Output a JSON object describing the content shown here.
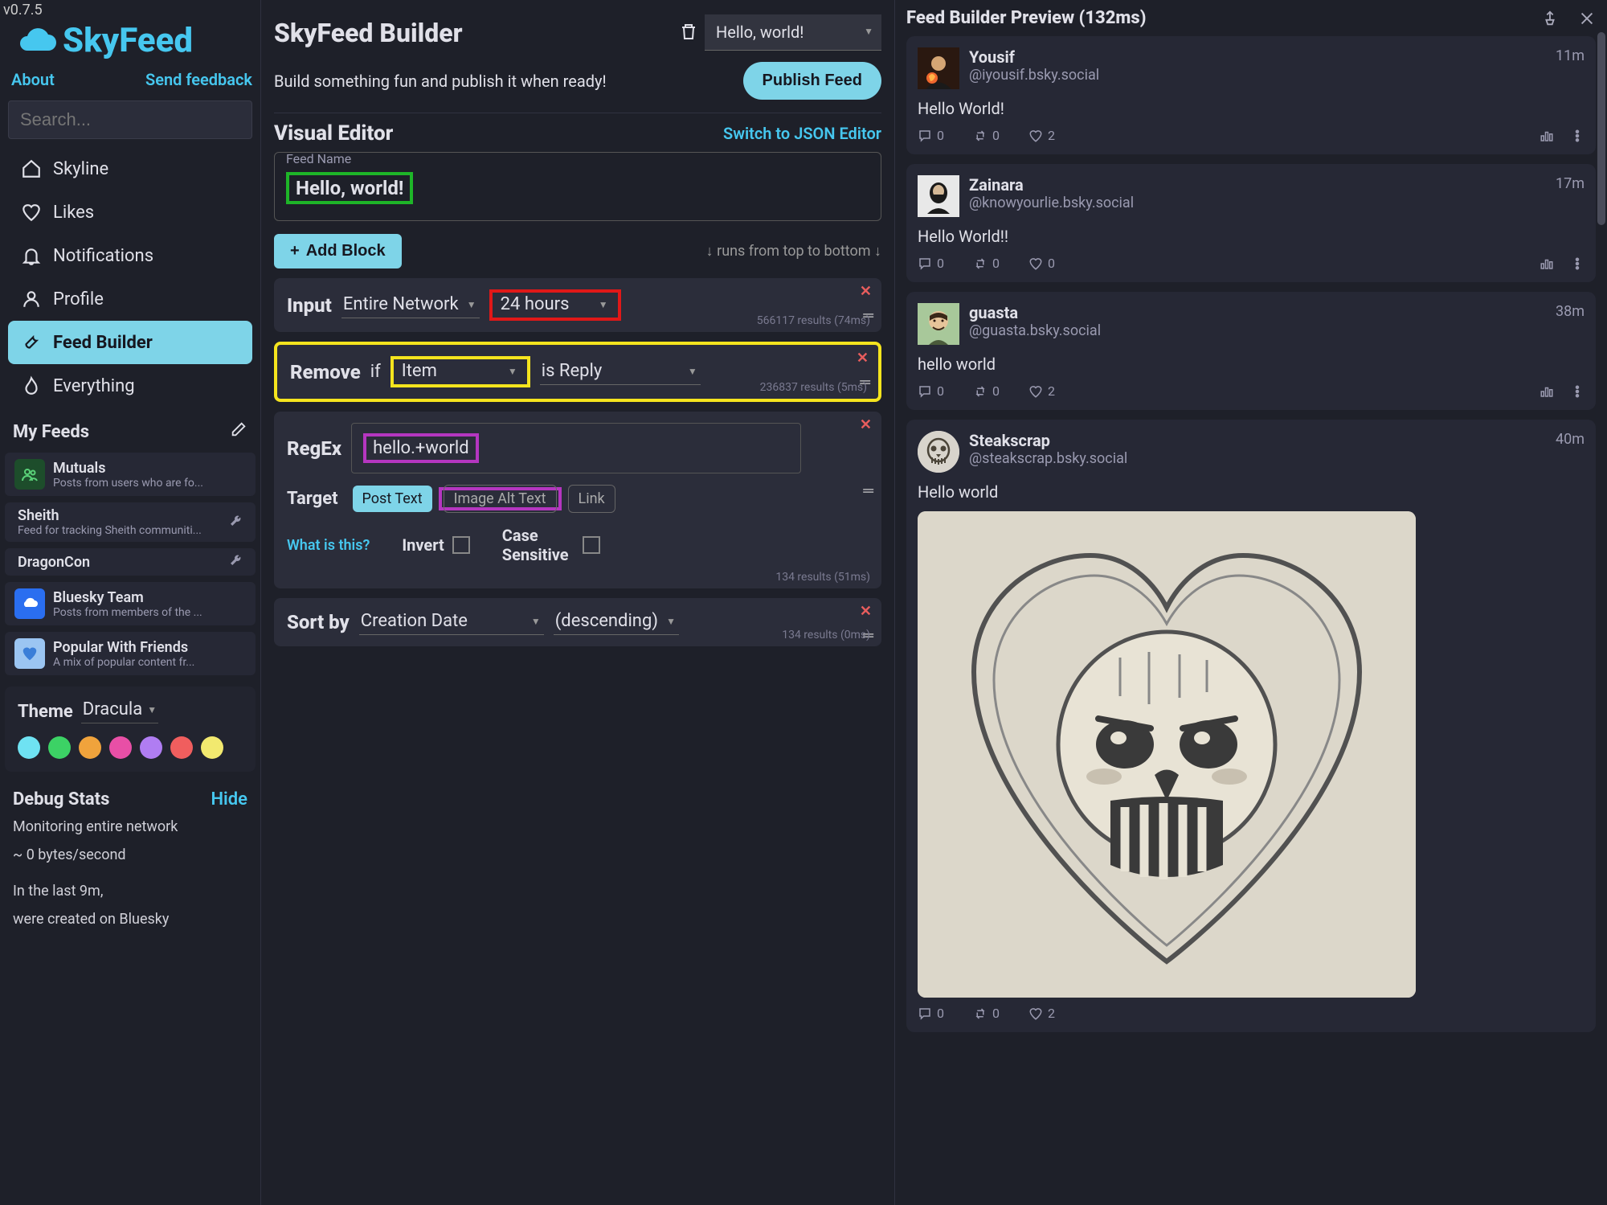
{
  "version": "v0.7.5",
  "logo": "SkyFeed",
  "top_links": {
    "about": "About",
    "feedback": "Send feedback"
  },
  "search_placeholder": "Search...",
  "nav": [
    {
      "label": "Skyline",
      "icon": "home"
    },
    {
      "label": "Likes",
      "icon": "heart"
    },
    {
      "label": "Notifications",
      "icon": "bell"
    },
    {
      "label": "Profile",
      "icon": "user"
    },
    {
      "label": "Feed Builder",
      "icon": "wrench",
      "active": true
    },
    {
      "label": "Everything",
      "icon": "flame"
    }
  ],
  "my_feeds_header": "My Feeds",
  "my_feeds": [
    {
      "title": "Mutuals",
      "sub": "Posts from users who are fo...",
      "icon": "users",
      "color": "green"
    },
    {
      "title": "Sheith",
      "sub": "Feed for tracking Sheith communiti...",
      "simple": true
    },
    {
      "title": "DragonCon",
      "sub": "",
      "simple": true
    },
    {
      "title": "Bluesky Team",
      "sub": "Posts from members of the ...",
      "icon": "cloud",
      "color": "blue"
    },
    {
      "title": "Popular With Friends",
      "sub": "A mix of popular content fr...",
      "icon": "heart",
      "color": "lightblue"
    }
  ],
  "theme": {
    "label": "Theme",
    "value": "Dracula",
    "colors": [
      "#6fe2f2",
      "#3cd265",
      "#f0a33c",
      "#e84fa6",
      "#b07df2",
      "#f05e5e",
      "#f2e96f"
    ]
  },
  "debug": {
    "title": "Debug Stats",
    "hide": "Hide",
    "line1": "Monitoring entire network",
    "line2": "~ 0 bytes/second",
    "line3": "In the last 9m,",
    "line4": "were created on Bluesky"
  },
  "builder": {
    "title": "SkyFeed Builder",
    "feed_select": "Hello, world!",
    "subtitle": "Build something fun and publish it when ready!",
    "publish": "Publish Feed",
    "editor_title": "Visual Editor",
    "json_link": "Switch to JSON Editor",
    "feed_name_label": "Feed Name",
    "feed_name_value": "Hello, world!",
    "add_block": "Add Block",
    "runs_text": "↓ runs from top to bottom ↓",
    "blocks": {
      "input": {
        "label": "Input",
        "source": "Entire Network",
        "window": "24 hours",
        "meta": "566117 results (74ms)"
      },
      "remove": {
        "label": "Remove",
        "if": "if",
        "subject": "Item",
        "predicate": "is Reply",
        "meta": "236837 results (5ms)"
      },
      "regex": {
        "label": "RegEx",
        "value": "hello.+world",
        "target_label": "Target",
        "chips": [
          "Post Text",
          "Image Alt Text",
          "Link"
        ],
        "what": "What is this?",
        "invert": "Invert",
        "case": "Case Sensitive",
        "meta": "134 results (51ms)"
      },
      "sort": {
        "label": "Sort by",
        "field": "Creation Date",
        "order": "(descending)",
        "meta": "134 results (0ms)"
      }
    }
  },
  "preview": {
    "title": "Feed Builder Preview (132ms)",
    "posts": [
      {
        "name": "Yousif",
        "handle": "@iyousif.bsky.social",
        "time": "11m",
        "text": "Hello World!",
        "replies": "0",
        "reposts": "0",
        "likes": "2"
      },
      {
        "name": "Zainara",
        "handle": "@knowyourlie.bsky.social",
        "time": "17m",
        "text": "Hello World!!",
        "replies": "0",
        "reposts": "0",
        "likes": "0"
      },
      {
        "name": "guasta",
        "handle": "@guasta.bsky.social",
        "time": "38m",
        "text": "hello world",
        "replies": "0",
        "reposts": "0",
        "likes": "2"
      },
      {
        "name": "Steakscrap",
        "handle": "@steakscrap.bsky.social",
        "time": "40m",
        "text": "Hello world",
        "replies": "0",
        "reposts": "0",
        "likes": "2",
        "has_image": true
      }
    ]
  }
}
